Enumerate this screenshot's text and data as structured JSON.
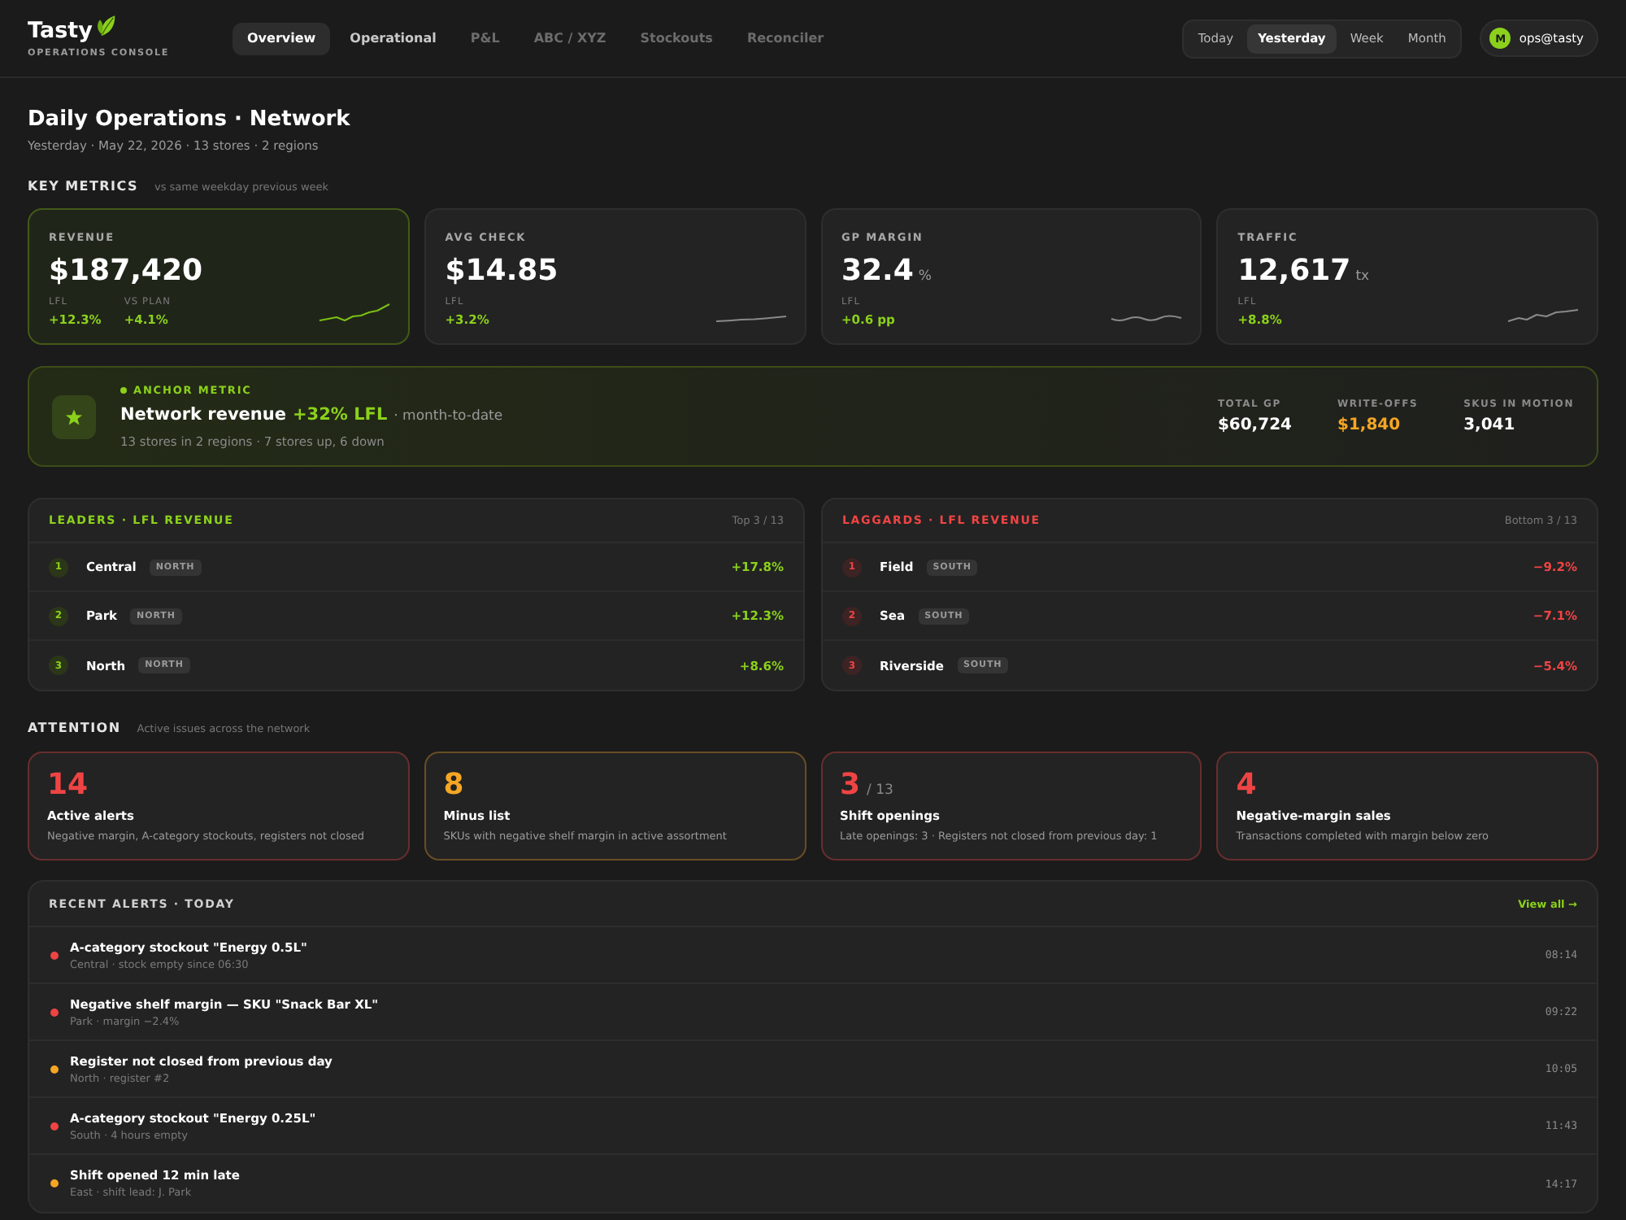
{
  "header": {
    "logo": {
      "name": "Tasty",
      "tagline": "OPERATIONS CONSOLE"
    },
    "nav": [
      {
        "label": "Overview",
        "selected": true,
        "disabled": false
      },
      {
        "label": "Operational",
        "selected": false,
        "disabled": false
      },
      {
        "label": "P&L",
        "selected": false,
        "disabled": true
      },
      {
        "label": "ABC / XYZ",
        "selected": false,
        "disabled": true
      },
      {
        "label": "Stockouts",
        "selected": false,
        "disabled": true
      },
      {
        "label": "Reconciler",
        "selected": false,
        "disabled": true
      }
    ],
    "periods": [
      {
        "label": "Today",
        "selected": false
      },
      {
        "label": "Yesterday",
        "selected": true
      },
      {
        "label": "Week",
        "selected": false
      },
      {
        "label": "Month",
        "selected": false
      }
    ],
    "user": {
      "initial": "M",
      "name": "ops@tasty"
    }
  },
  "page": {
    "title": "Daily Operations · Network",
    "subtitle": "Yesterday · May 22, 2026 · 13 stores · 2 regions"
  },
  "key_metrics": {
    "title": "KEY METRICS",
    "note": "vs same weekday previous week",
    "cards": [
      {
        "label": "REVENUE",
        "value": "$187,420",
        "highlighted": true,
        "deltas": [
          {
            "label": "LFL",
            "value": "+12.3%"
          },
          {
            "label": "VS PLAN",
            "value": "+4.1%"
          }
        ]
      },
      {
        "label": "AVG CHECK",
        "value": "$14.85",
        "highlighted": false,
        "deltas": [
          {
            "label": "LFL",
            "value": "+3.2%"
          }
        ]
      },
      {
        "label": "GP MARGIN",
        "value": "32.4",
        "unit": "%",
        "highlighted": false,
        "deltas": [
          {
            "label": "LFL",
            "value": "+0.6 pp"
          }
        ]
      },
      {
        "label": "TRAFFIC",
        "value": "12,617",
        "unit": "tx",
        "highlighted": false,
        "deltas": [
          {
            "label": "LFL",
            "value": "+8.8%"
          }
        ]
      }
    ]
  },
  "anchor": {
    "eyebrow": "ANCHOR METRIC",
    "title": "Network revenue",
    "delta": "+32% LFL",
    "suffix": "· month-to-date",
    "subtitle": "13 stores in 2 regions · 7 stores up, 6 down",
    "stats": [
      {
        "label": "TOTAL GP",
        "value": "$60,724",
        "color": "#ffffff"
      },
      {
        "label": "WRITE-OFFS",
        "value": "$1,840",
        "color": "#f5a623"
      },
      {
        "label": "SKUS IN MOTION",
        "value": "3,041",
        "color": "#ffffff"
      }
    ]
  },
  "rankings": [
    {
      "kind": "leaders",
      "title": "LEADERS · LFL REVENUE",
      "scope": "Top 3 / 13",
      "rows": [
        {
          "rank": "1",
          "name": "Central",
          "region": "NORTH",
          "delta": "+17.8%"
        },
        {
          "rank": "2",
          "name": "Park",
          "region": "NORTH",
          "delta": "+12.3%"
        },
        {
          "rank": "3",
          "name": "North",
          "region": "NORTH",
          "delta": "+8.6%"
        }
      ]
    },
    {
      "kind": "laggards",
      "title": "LAGGARDS · LFL REVENUE",
      "scope": "Bottom 3 / 13",
      "rows": [
        {
          "rank": "1",
          "name": "Field",
          "region": "SOUTH",
          "delta": "−9.2%"
        },
        {
          "rank": "2",
          "name": "Sea",
          "region": "SOUTH",
          "delta": "−7.1%"
        },
        {
          "rank": "3",
          "name": "Riverside",
          "region": "SOUTH",
          "delta": "−5.4%"
        }
      ]
    }
  ],
  "attention": {
    "title": "ATTENTION",
    "note": "Active issues across the network",
    "cards": [
      {
        "value": "14",
        "title": "Active alerts",
        "description": "Negative margin, A-category stockouts, registers not closed",
        "color": "#ef4444"
      },
      {
        "value": "8",
        "title": "Minus list",
        "description": "SKUs with negative shelf margin in active assortment",
        "color": "#f5a623"
      },
      {
        "value": "3",
        "total": "/ 13",
        "title": "Shift openings",
        "description": "Late openings: 3 · Registers not closed from previous day: 1",
        "color": "#ef4444"
      },
      {
        "value": "4",
        "title": "Negative-margin sales",
        "description": "Transactions completed with margin below zero",
        "color": "#ef4444"
      }
    ]
  },
  "recent_alerts": {
    "title": "RECENT ALERTS · TODAY",
    "link": "View all →",
    "items": [
      {
        "title": "A-category stockout \"Energy 0.5L\"",
        "detail": "Central · stock empty since 06:30",
        "time": "08:14",
        "color": "#ef4444"
      },
      {
        "title": "Negative shelf margin — SKU \"Snack Bar XL\"",
        "detail": "Park · margin −2.4%",
        "time": "09:22",
        "color": "#ef4444"
      },
      {
        "title": "Register not closed from previous day",
        "detail": "North · register #2",
        "time": "10:05",
        "color": "#f5a623"
      },
      {
        "title": "A-category stockout \"Energy 0.25L\"",
        "detail": "South · 4 hours empty",
        "time": "11:43",
        "color": "#ef4444"
      },
      {
        "title": "Shift opened 12 min late",
        "detail": "East · shift lead: J. Park",
        "time": "14:17",
        "color": "#f5a623"
      }
    ]
  }
}
